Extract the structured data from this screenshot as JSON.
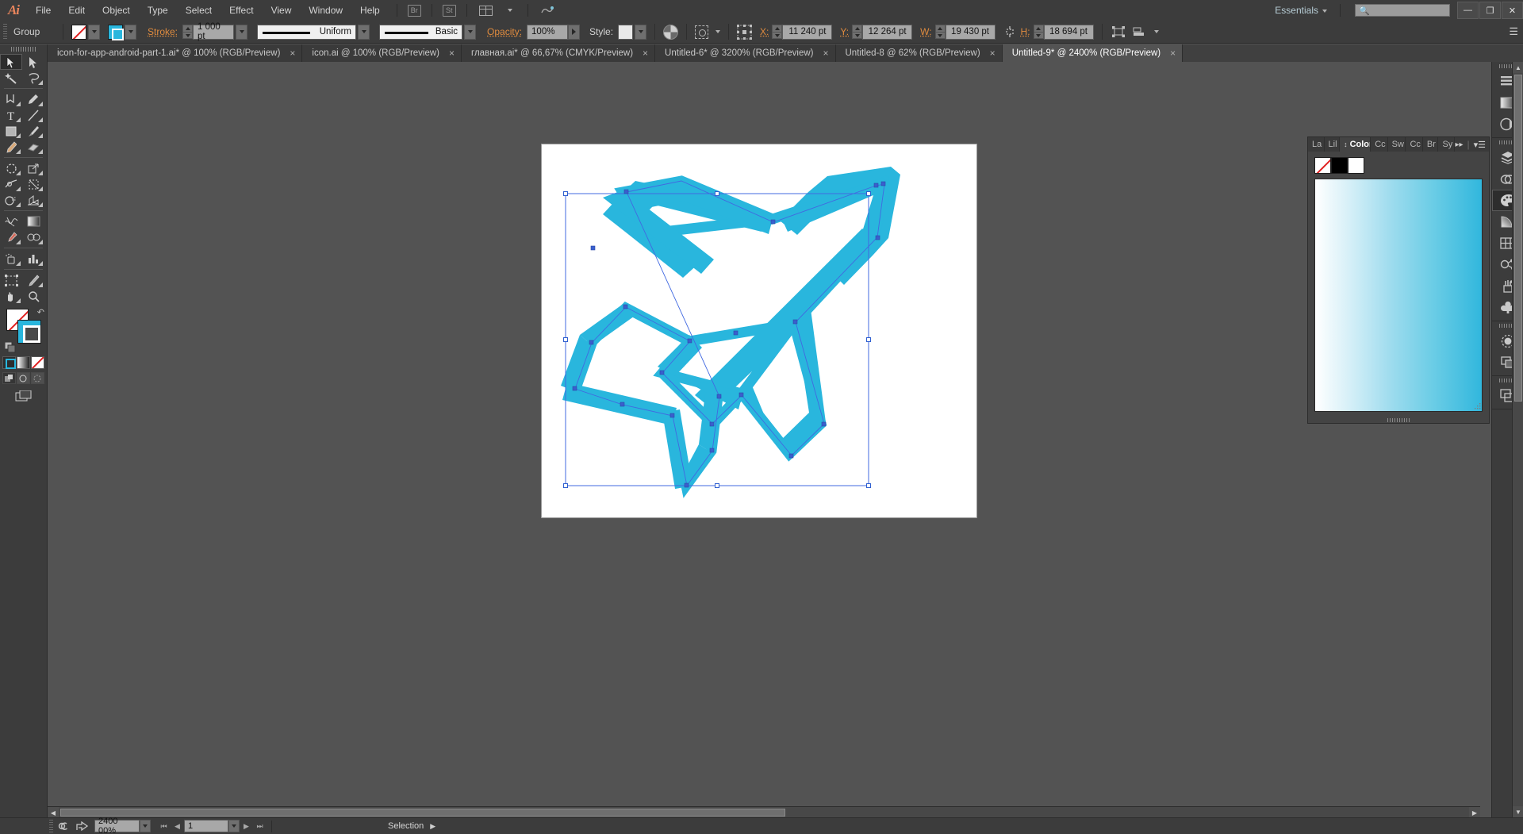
{
  "app": {
    "logo": "Ai",
    "workspace": "Essentials",
    "search_placeholder": ""
  },
  "menubar": {
    "items": [
      "File",
      "Edit",
      "Object",
      "Type",
      "Select",
      "Effect",
      "View",
      "Window",
      "Help"
    ],
    "bridge_label": "Br",
    "stock_label": "St"
  },
  "window_controls": {
    "minimize": "—",
    "restore": "❐",
    "close": "✕"
  },
  "controlbar": {
    "selection_label": "Group",
    "fill_swatch": "none",
    "stroke_swatch_color": "#29b6dd",
    "stroke_label": "Stroke:",
    "stroke_weight": "1 000 pt",
    "stroke_profile": "Uniform",
    "brush_definition": "Basic",
    "opacity_label": "Opacity:",
    "opacity_value": "100%",
    "style_label": "Style:",
    "x_label": "X:",
    "x_value": "11 240 pt",
    "y_label": "Y:",
    "y_value": "12 264 pt",
    "w_label": "W:",
    "w_value": "19 430 pt",
    "h_label": "H:",
    "h_value": "18 694 pt"
  },
  "tabs": [
    {
      "label": "icon-for-app-android-part-1.ai* @ 100% (RGB/Preview)",
      "close": "×",
      "active": false
    },
    {
      "label": "icon.ai @ 100% (RGB/Preview)",
      "close": "×",
      "active": false
    },
    {
      "label": "главная.ai* @ 66,67% (CMYK/Preview)",
      "close": "×",
      "active": false
    },
    {
      "label": "Untitled-6* @ 3200% (RGB/Preview)",
      "close": "×",
      "active": false
    },
    {
      "label": "Untitled-8 @ 62% (RGB/Preview)",
      "close": "×",
      "active": false
    },
    {
      "label": "Untitled-9* @ 2400% (RGB/Preview)",
      "close": "×",
      "active": true
    }
  ],
  "toolbar": {
    "tools": [
      [
        "selection-tool",
        "direct-selection-tool"
      ],
      [
        "magic-wand-tool",
        "lasso-tool"
      ],
      [
        "pen-tool",
        "curvature-tool"
      ],
      [
        "type-tool",
        "line-segment-tool"
      ],
      [
        "rectangle-tool",
        "paintbrush-tool"
      ],
      [
        "pencil-tool",
        "eraser-tool"
      ],
      [
        "rotate-tool",
        "scale-tool"
      ],
      [
        "width-tool",
        "free-transform-tool"
      ],
      [
        "shape-builder-tool",
        "perspective-grid-tool"
      ],
      [
        "mesh-tool",
        "gradient-tool"
      ],
      [
        "eyedropper-tool",
        "blend-tool"
      ],
      [
        "symbol-sprayer-tool",
        "column-graph-tool"
      ],
      [
        "artboard-tool",
        "slice-tool"
      ],
      [
        "hand-tool",
        "zoom-tool"
      ]
    ],
    "fill_color": "none",
    "stroke_color": "#29b6dd",
    "color_modes": [
      "color-mode",
      "gradient-mode",
      "none-mode"
    ],
    "drawing_modes": [
      "draw-normal",
      "draw-behind",
      "draw-inside"
    ],
    "screen_mode": "change-screen-mode"
  },
  "color_panel": {
    "tabs": [
      "La",
      "Lil",
      "Color",
      "Cc",
      "Sw",
      "Cc",
      "Br",
      "Sy"
    ],
    "active_tab": "Color",
    "swatches": [
      "none",
      "#000000",
      "#ffffff"
    ],
    "spectrum_from": "#ffffff",
    "spectrum_to": "#31b7dd"
  },
  "right_dock": {
    "groups": [
      [
        "properties-panel-icon",
        "gradient-panel-icon",
        "transparency-panel-icon"
      ],
      [
        "layers-panel-icon",
        "links-panel-icon",
        "color-panel-icon",
        "gradient2-panel-icon",
        "swatches-panel-icon",
        "color-guide-panel-icon",
        "brushes-panel-icon",
        "symbols-panel-icon"
      ],
      [
        "appearance-panel-icon",
        "pathfinder-panel-icon"
      ],
      [
        "artboards-panel-icon"
      ]
    ],
    "active": "color-panel-icon"
  },
  "statusbar": {
    "zoom_value": "2400 00%",
    "artboard_number": "1",
    "status_text": "Selection"
  },
  "artwork": {
    "name": "airplane-icon",
    "stroke_color": "#29b6dd",
    "selection_color": "#4169e1"
  }
}
